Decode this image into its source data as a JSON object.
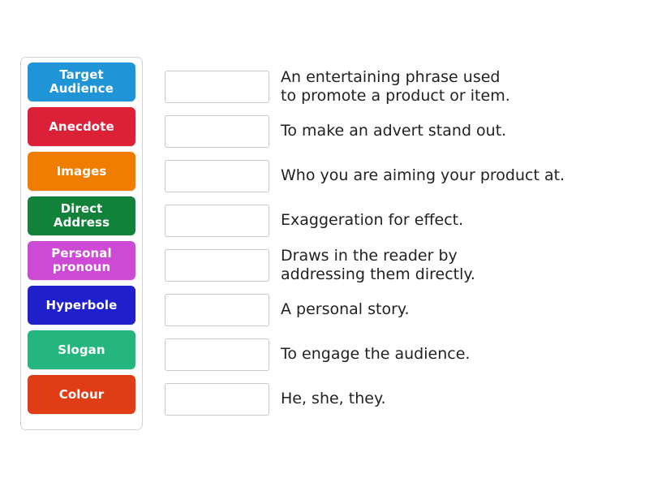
{
  "activity": {
    "type": "match-up-drag-and-drop",
    "tray_label": "answer-tiles-tray"
  },
  "tiles": [
    {
      "label": "Target\nAudience",
      "color": "#1f95d8",
      "text_color": "#ffffff",
      "name": "tile-target-audience"
    },
    {
      "label": "Anecdote",
      "color": "#dc2038",
      "text_color": "#ffffff",
      "name": "tile-anecdote"
    },
    {
      "label": "Images",
      "color": "#f07d00",
      "text_color": "#ffffff",
      "name": "tile-images"
    },
    {
      "label": "Direct\nAddress",
      "color": "#12823a",
      "text_color": "#ffffff",
      "name": "tile-direct-address"
    },
    {
      "label": "Personal\npronoun",
      "color": "#cc4ad4",
      "text_color": "#ffffff",
      "name": "tile-personal-pronoun"
    },
    {
      "label": "Hyperbole",
      "color": "#1f1fcc",
      "text_color": "#ffffff",
      "name": "tile-hyperbole"
    },
    {
      "label": "Slogan",
      "color": "#25b57e",
      "text_color": "#ffffff",
      "name": "tile-slogan"
    },
    {
      "label": "Colour",
      "color": "#e03c16",
      "text_color": "#ffffff",
      "name": "tile-colour"
    }
  ],
  "rows": [
    {
      "drop_value": "",
      "definition": "An entertaining phrase used\nto promote a product or item."
    },
    {
      "drop_value": "",
      "definition": "To make an advert stand out."
    },
    {
      "drop_value": "",
      "definition": "Who you are aiming your product at."
    },
    {
      "drop_value": "",
      "definition": "Exaggeration for effect."
    },
    {
      "drop_value": "",
      "definition": "Draws in the reader by\naddressing them directly."
    },
    {
      "drop_value": "",
      "definition": "A personal story."
    },
    {
      "drop_value": "",
      "definition": "To engage the audience."
    },
    {
      "drop_value": "",
      "definition": "He, she, they."
    }
  ]
}
